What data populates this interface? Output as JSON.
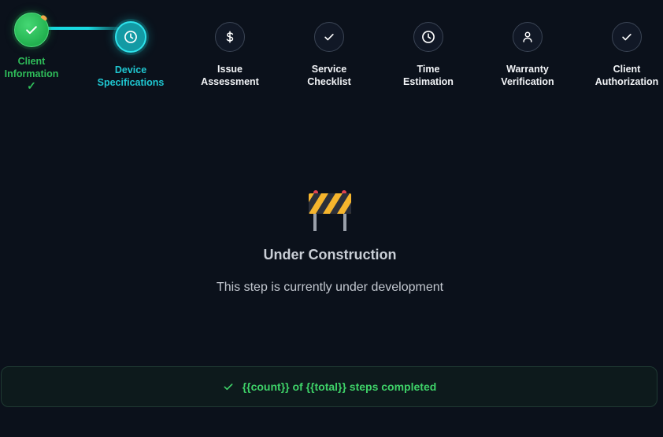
{
  "steps": [
    {
      "label": "Client Information",
      "status": "completed",
      "icon": "check-icon",
      "done_mark": "✓"
    },
    {
      "label": "Device Specifications",
      "status": "active",
      "icon": "clock-icon"
    },
    {
      "label": "Issue Assessment",
      "status": "pending",
      "icon": "dollar-icon"
    },
    {
      "label": "Service Checklist",
      "status": "pending",
      "icon": "check-icon"
    },
    {
      "label": "Time Estimation",
      "status": "pending",
      "icon": "clock-icon"
    },
    {
      "label": "Warranty Verification",
      "status": "pending",
      "icon": "user-icon"
    },
    {
      "label": "Client Authorization",
      "status": "pending",
      "icon": "check-icon"
    }
  ],
  "content": {
    "icon": "construction-barrier-icon",
    "title": "Under Construction",
    "message": "This step is currently under development"
  },
  "footer": {
    "icon": "check-icon",
    "text": "{{count}} of {{total}} steps completed"
  },
  "colors": {
    "background": "#0b111b",
    "active": "#19d9e0",
    "completed": "#22b14f",
    "pending_border": "#3a4454"
  }
}
